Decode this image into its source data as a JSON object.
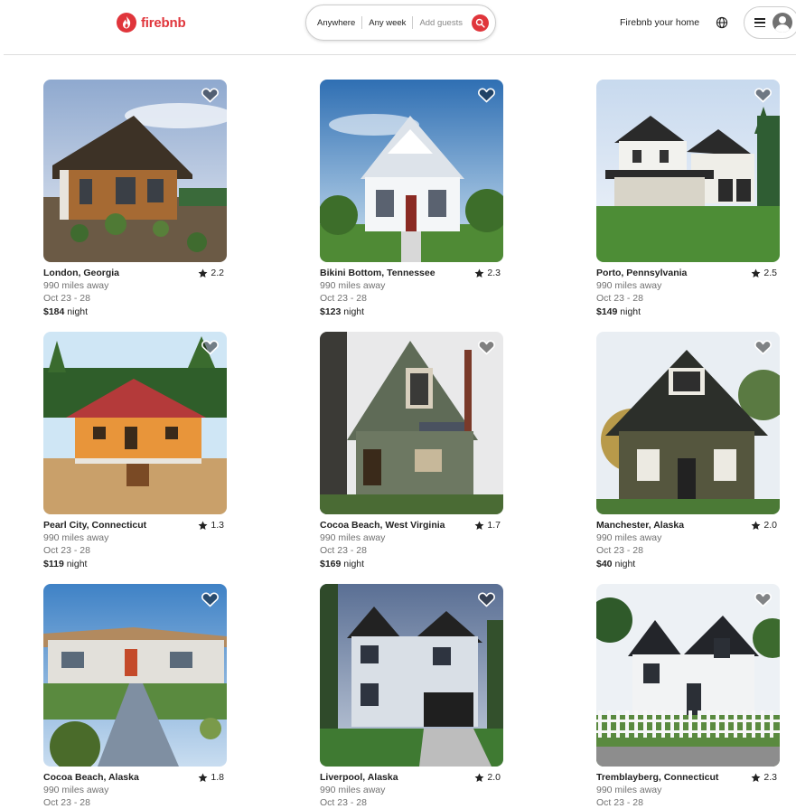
{
  "app": {
    "logo_text": "firebnb",
    "brand_color": "#e0353b"
  },
  "search": {
    "location": "Anywhere",
    "dates": "Any week",
    "guests_placeholder": "Add guests",
    "icon": "search-icon"
  },
  "header": {
    "host_link": "Firebnb your home",
    "globe_icon": "globe-icon",
    "menu_icon": "hamburger-icon",
    "avatar_icon": "user-avatar-icon"
  },
  "listings": [
    {
      "location": "London, Georgia",
      "rating": "2.2",
      "distance": "990 miles away",
      "dates": "Oct 23 - 28",
      "price": "$184",
      "price_unit": "night",
      "favorited": false
    },
    {
      "location": "Bikini Bottom, Tennessee",
      "rating": "2.3",
      "distance": "990 miles away",
      "dates": "Oct 23 - 28",
      "price": "$123",
      "price_unit": "night",
      "favorited": false
    },
    {
      "location": "Porto, Pennsylvania",
      "rating": "2.5",
      "distance": "990 miles away",
      "dates": "Oct 23 - 28",
      "price": "$149",
      "price_unit": "night",
      "favorited": false
    },
    {
      "location": "Pearl City, Connecticut",
      "rating": "1.3",
      "distance": "990 miles away",
      "dates": "Oct 23 - 28",
      "price": "$119",
      "price_unit": "night",
      "favorited": false
    },
    {
      "location": "Cocoa Beach, West Virginia",
      "rating": "1.7",
      "distance": "990 miles away",
      "dates": "Oct 23 - 28",
      "price": "$169",
      "price_unit": "night",
      "favorited": false
    },
    {
      "location": "Manchester, Alaska",
      "rating": "2.0",
      "distance": "990 miles away",
      "dates": "Oct 23 - 28",
      "price": "$40",
      "price_unit": "night",
      "favorited": false
    },
    {
      "location": "Cocoa Beach, Alaska",
      "rating": "1.8",
      "distance": "990 miles away",
      "dates": "Oct 23 - 28",
      "price": "",
      "price_unit": "",
      "favorited": false
    },
    {
      "location": "Liverpool, Alaska",
      "rating": "2.0",
      "distance": "990 miles away",
      "dates": "Oct 23 - 28",
      "price": "",
      "price_unit": "",
      "favorited": false
    },
    {
      "location": "Tremblayberg, Connecticut",
      "rating": "2.3",
      "distance": "990 miles away",
      "dates": "Oct 23 - 28",
      "price": "",
      "price_unit": "",
      "favorited": false
    }
  ]
}
